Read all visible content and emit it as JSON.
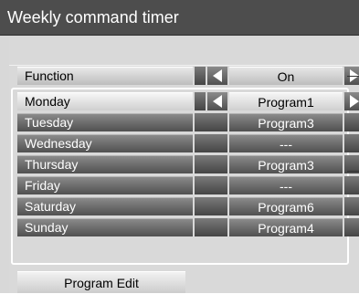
{
  "title": "Weekly command timer",
  "function_row": {
    "label": "Function",
    "value": "On",
    "icons": [
      "arrow-left-icon",
      "arrow-right-icon"
    ]
  },
  "days": [
    {
      "label": "Monday",
      "value": "Program1",
      "selected": true
    },
    {
      "label": "Tuesday",
      "value": "Program3",
      "selected": false
    },
    {
      "label": "Wednesday",
      "value": "---",
      "selected": false
    },
    {
      "label": "Thursday",
      "value": "Program3",
      "selected": false
    },
    {
      "label": "Friday",
      "value": "---",
      "selected": false
    },
    {
      "label": "Saturday",
      "value": "Program6",
      "selected": false
    },
    {
      "label": "Sunday",
      "value": "Program4",
      "selected": false
    }
  ],
  "program_edit_label": "Program Edit",
  "colors": {
    "title_bar": "#4d4d4d",
    "panel": "#d8d8d8",
    "row_dark": "#5a5a5a",
    "row_selected": "#e0e0e0"
  }
}
